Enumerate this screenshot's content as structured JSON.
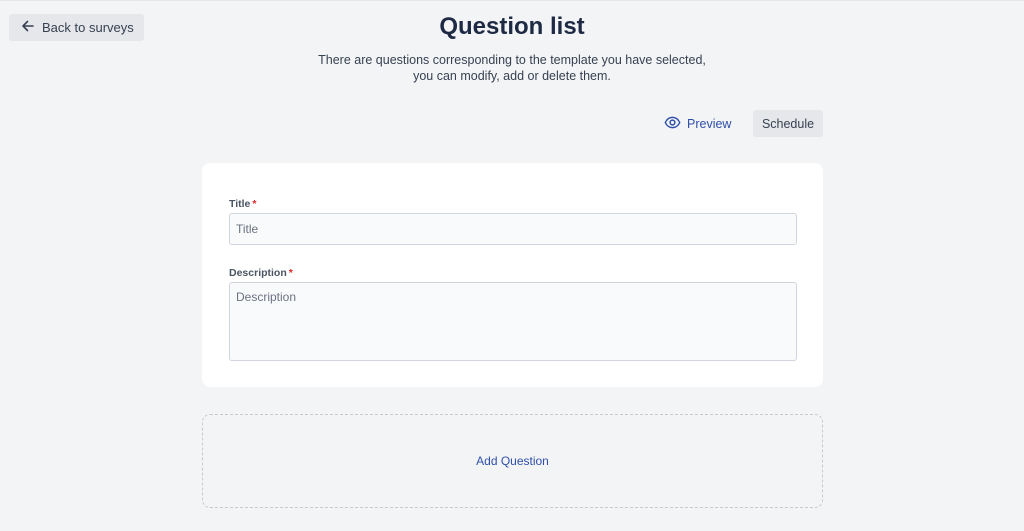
{
  "header": {
    "back_label": "Back to surveys",
    "title": "Question list",
    "subtitle": "There are questions corresponding to the template you have selected, you can modify, add or delete them."
  },
  "toolbar": {
    "preview_label": "Preview",
    "schedule_label": "Schedule"
  },
  "form": {
    "title_label": "Title",
    "title_required": "*",
    "title_placeholder": "Title",
    "title_value": "",
    "description_label": "Description",
    "description_required": "*",
    "description_placeholder": "Description",
    "description_value": ""
  },
  "actions": {
    "add_question_label": "Add Question"
  },
  "colors": {
    "accent": "#2f4fa8",
    "required": "#dc2626",
    "background": "#f3f4f6"
  }
}
